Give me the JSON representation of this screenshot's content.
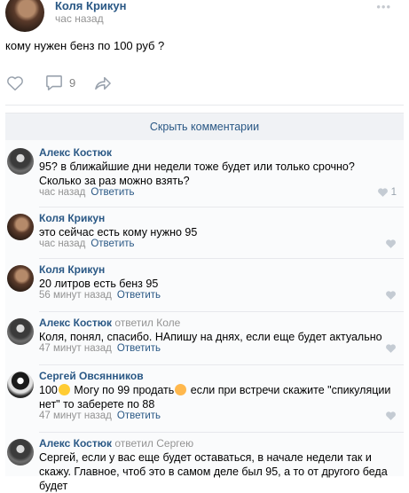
{
  "post": {
    "author": "Коля Крикун",
    "time": "час назад",
    "text": "кому нужен бенз по 100 руб ?",
    "more_icon": "•••",
    "comment_count": "9"
  },
  "comments_panel": {
    "hide_label": "Скрыть комментарии"
  },
  "comments": [
    {
      "author": "Алекс Костюк",
      "reply_to": "",
      "text": "95? в ближайшие дни недели тоже будет или только срочно? Сколько за раз можно взять?",
      "time": "час назад",
      "reply_label": "Ответить",
      "likes": "1"
    },
    {
      "author": "Коля Крикун",
      "reply_to": "",
      "text": "это сейчас есть кому нужно 95",
      "time": "час назад",
      "reply_label": "Ответить",
      "likes": ""
    },
    {
      "author": "Коля Крикун",
      "reply_to": "",
      "text": "20 литров есть бенз 95",
      "time": "56 минут назад",
      "reply_label": "Ответить",
      "likes": ""
    },
    {
      "author": "Алекс Костюк",
      "reply_to": "ответил Коле",
      "text": "Коля, понял, спасибо. НАпишу на днях, если еще будет актуально",
      "time": "47 минут назад",
      "reply_label": "Ответить",
      "likes": ""
    },
    {
      "author": "Сергей Овсянников",
      "reply_to": "",
      "text_part1": "100",
      "text_part2": " Могу по 99 продать",
      "text_part3": " если при встречи скажите \"спикуляции нет\" то заберете по 88",
      "time": "47 минут назад",
      "reply_label": "Ответить",
      "likes": ""
    },
    {
      "author": "Алекс Костюк",
      "reply_to": "ответил Сергею",
      "text": "Сергей, если у вас еще будет оставаться, в начале недели так и скажу. Главное, чтоб это в самом деле был 95, а то от другого беда будет",
      "time": "",
      "reply_label": "",
      "likes": ""
    }
  ],
  "colors": {
    "link": "#2a5885",
    "muted": "#939393",
    "icon": "#99a2ad"
  },
  "icons": {
    "like": "heart-icon",
    "comment": "comment-icon",
    "share": "share-arrow-icon"
  }
}
